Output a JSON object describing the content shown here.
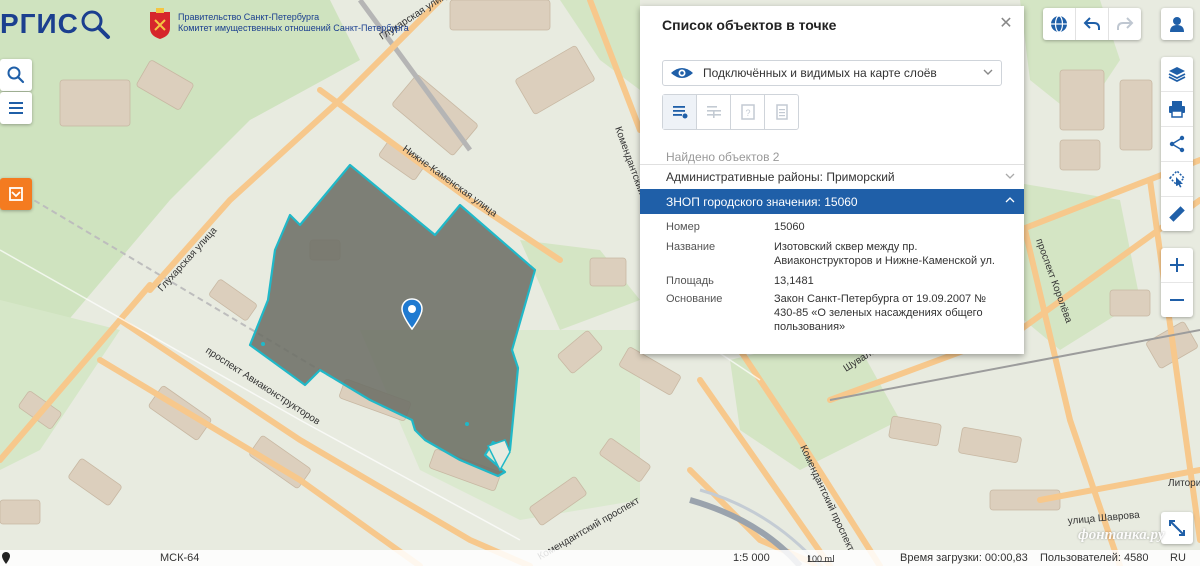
{
  "logo": {
    "text": "РГИС"
  },
  "government": {
    "line1": "Правительство Санкт-Петербурга",
    "line2": "Комитет имущественных отношений Санкт-Петербурга"
  },
  "streets": {
    "glukharskaya_top": "Глухарская улица",
    "glukharskaya_left": "Глухарская улица",
    "nizhne_kamenskaya": "Нижне-Каменская улица",
    "aviakonstruktorov": "проспект Авиаконструкторов",
    "komendantsky_top": "Комендантский",
    "komendantsky_bottom": "Комендантский проспект",
    "komendantsky_bottom_left": "Комендантский проспект",
    "shuvalovsky": "Шуваловский",
    "korolyova": "проспект Королёва",
    "shavrova": "улица Шаврова",
    "litorina": "Литори"
  },
  "panel": {
    "title": "Список объектов в точке",
    "layer_select": "Подключённых и видимых на карте слоёв",
    "found": "Найдено объектов 2",
    "collapsed_group": "Административные районы: Приморский",
    "active_group": "ЗНОП городского значения: 15060",
    "attributes": [
      {
        "key": "Номер",
        "value": "15060"
      },
      {
        "key": "Название",
        "value": "Изотовский сквер между пр. Авиаконструкторов и Нижне-Каменской ул."
      },
      {
        "key": "Площадь",
        "value": "13,1481"
      },
      {
        "key": "Основание",
        "value": "Закон Санкт-Петербурга от 19.09.2007 № 430-85 «О зеленых насаждениях общего пользования»"
      }
    ]
  },
  "statusbar": {
    "crs": "МСК-64",
    "scale": "1:5 000",
    "scale_bar_label": "100 m",
    "load_time": "Время загрузки: 00:00,83",
    "users": "Пользователей: 4580",
    "lang": "RU"
  },
  "watermark": "фонтанка.ру",
  "colors": {
    "accent": "#1f5fa8",
    "parcel_fill": "#6d7066",
    "parcel_outline": "#20b8c8",
    "road": "#f7c88c",
    "logo_blue": "#1b3f8f",
    "orange_button": "#f47b20"
  },
  "icons": {
    "search": "search-icon",
    "menu": "menu-icon",
    "basemap": "layers-icon",
    "globe": "globe-icon",
    "undo": "undo-icon",
    "redo": "redo-icon",
    "user": "user-icon",
    "print": "print-icon",
    "share": "share-icon",
    "select": "cursor-select-icon",
    "measure": "ruler-icon",
    "zoom_in": "plus-icon",
    "zoom_out": "minus-icon",
    "fullscreen": "expand-icon"
  }
}
